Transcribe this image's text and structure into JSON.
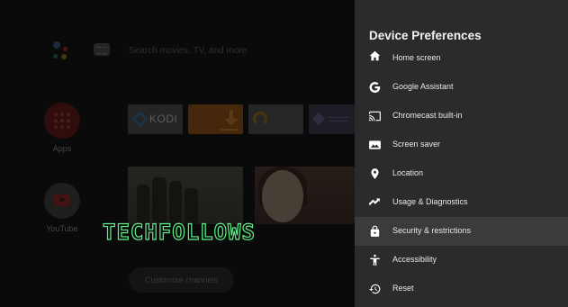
{
  "home": {
    "search_placeholder": "Search movies, TV, and more",
    "side_apps": [
      {
        "label": "Apps",
        "icon": "apps-grid-icon"
      },
      {
        "label": "YouTube",
        "icon": "youtube-icon"
      }
    ],
    "app_row": [
      {
        "label": "KODI",
        "icon": "kodi-icon"
      },
      {
        "label": "",
        "icon": "downloader-icon"
      },
      {
        "label": "",
        "icon": "streaming-app-icon"
      },
      {
        "label": "",
        "icon": "app-icon"
      }
    ],
    "customize_label": "Customize channels",
    "watermark": "TECHFOLLOWS"
  },
  "panel": {
    "title": "Device Preferences",
    "items": [
      {
        "label": "Home screen",
        "icon": "home-icon"
      },
      {
        "label": "Google Assistant",
        "icon": "google-icon"
      },
      {
        "label": "Chromecast built-in",
        "icon": "cast-icon"
      },
      {
        "label": "Screen saver",
        "icon": "screen-saver-icon"
      },
      {
        "label": "Location",
        "icon": "location-pin-icon"
      },
      {
        "label": "Usage & Diagnostics",
        "icon": "trend-icon"
      },
      {
        "label": "Security & restrictions",
        "icon": "lock-icon",
        "selected": true
      },
      {
        "label": "Accessibility",
        "icon": "accessibility-icon"
      },
      {
        "label": "Reset",
        "icon": "reset-icon"
      }
    ]
  },
  "colors": {
    "panel_bg": "#2b2b2b",
    "selected_bg": "#3b3b3b",
    "watermark_stroke": "#5ff08a"
  }
}
